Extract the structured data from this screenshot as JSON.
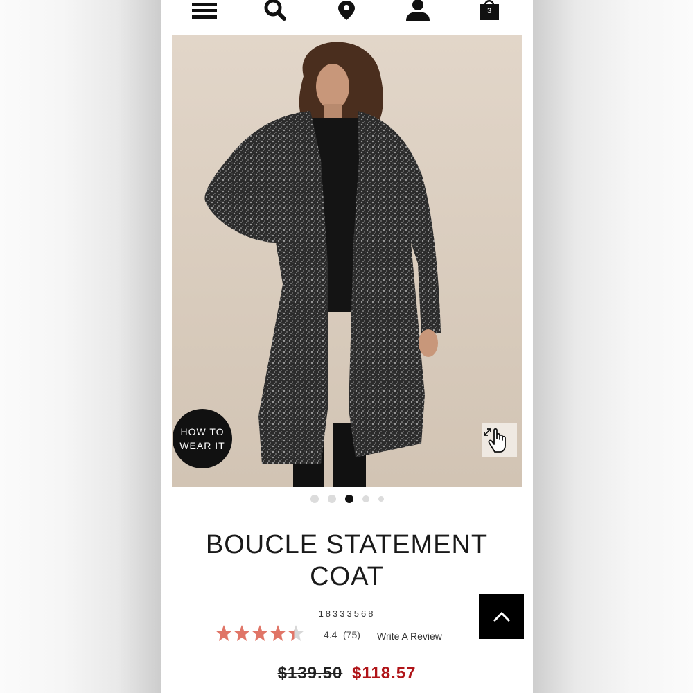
{
  "header": {
    "menu_icon": "hamburger-menu-icon",
    "search_icon": "search-icon",
    "store_locator_icon": "map-pin-icon",
    "account_icon": "user-icon",
    "cart_icon": "shopping-bag-icon",
    "cart_count": "3"
  },
  "gallery": {
    "how_to_wear_line1": "HOW TO",
    "how_to_wear_line2": "WEAR IT",
    "zoom_icon": "pinch-zoom-hand-icon",
    "slide_count": 5,
    "active_slide": 3
  },
  "product": {
    "title": "BOUCLE STATEMENT COAT",
    "sku": "18333568",
    "rating": "4.4",
    "rating_value": 4.4,
    "rating_max": 5,
    "review_count": "(75)",
    "write_review_label": "Write A Review",
    "price_original": "$139.50",
    "price_sale": "$118.57"
  },
  "colors": {
    "star": "#e07567",
    "star_empty": "#d7d7d7",
    "sale_price": "#b01418",
    "dark": "#111111"
  },
  "back_to_top_icon": "chevron-up-icon"
}
